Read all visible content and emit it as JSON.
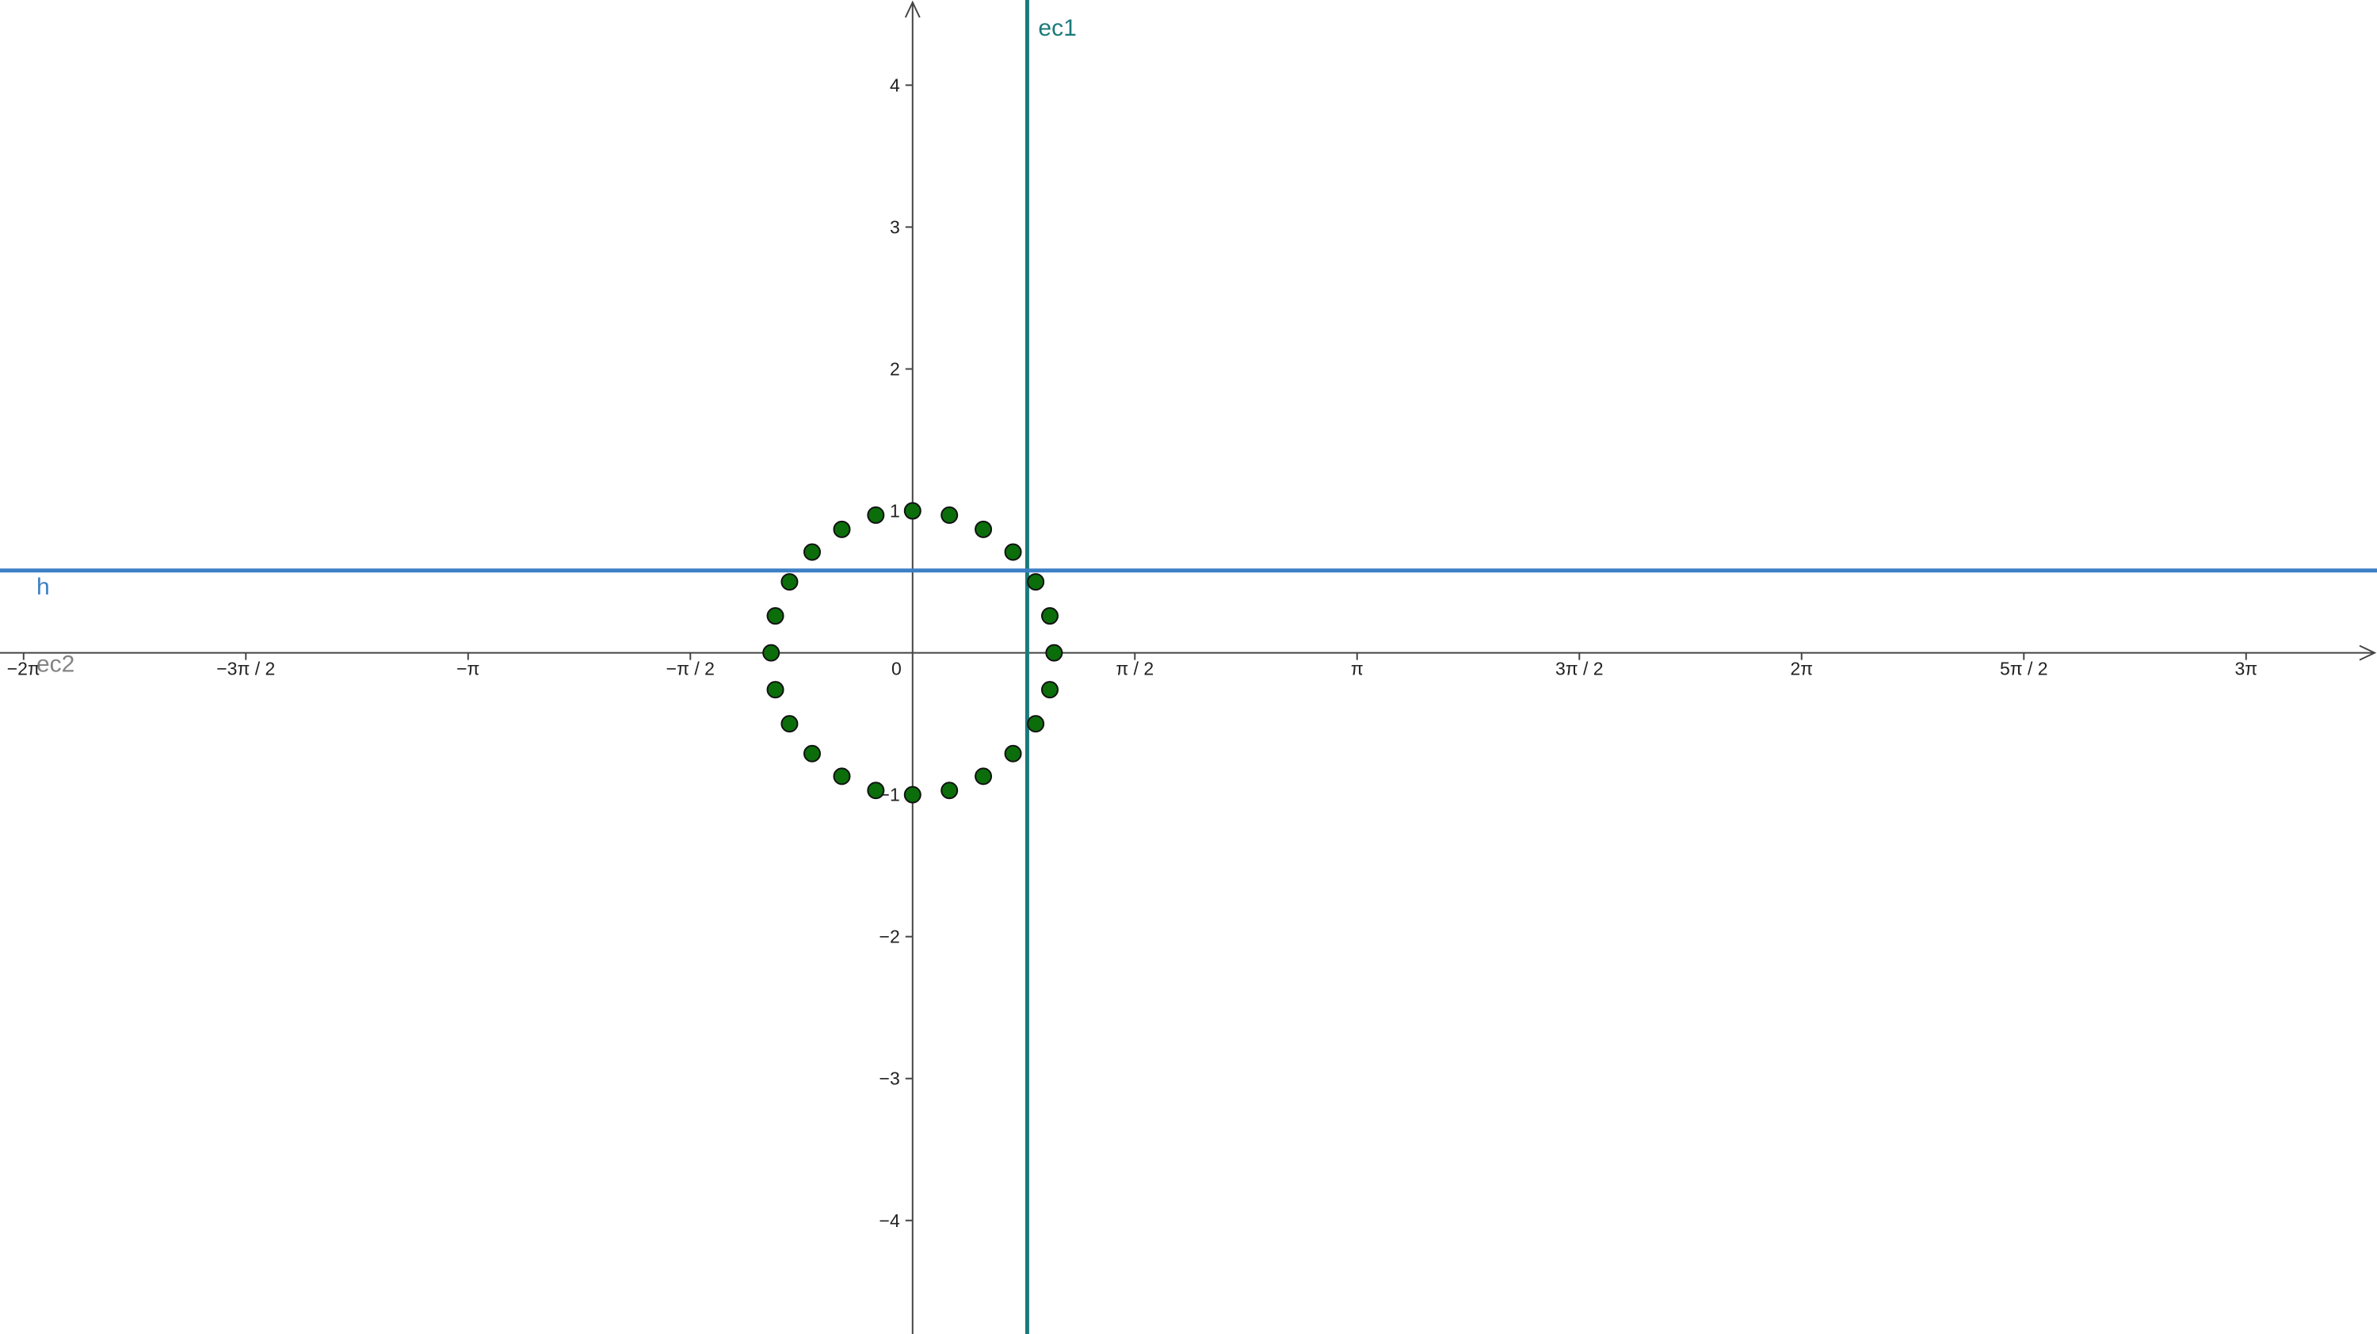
{
  "chart_data": {
    "type": "scatter",
    "x_unit": "radians",
    "xlim": [
      -6.45,
      10.35
    ],
    "ylim": [
      -4.8,
      4.6
    ],
    "grid": false,
    "x_ticks": [
      {
        "value": -6.283185,
        "label": "−2π"
      },
      {
        "value": -4.712389,
        "label": "−3π / 2"
      },
      {
        "value": -3.141593,
        "label": "−π"
      },
      {
        "value": -1.570796,
        "label": "−π / 2"
      },
      {
        "value": 1.570796,
        "label": "π / 2"
      },
      {
        "value": 3.141593,
        "label": "π"
      },
      {
        "value": 4.712389,
        "label": "3π / 2"
      },
      {
        "value": 6.283185,
        "label": "2π"
      },
      {
        "value": 7.853982,
        "label": "5π / 2"
      },
      {
        "value": 9.424778,
        "label": "3π"
      }
    ],
    "y_ticks": [
      {
        "value": -4,
        "label": "−4"
      },
      {
        "value": -3,
        "label": "−3"
      },
      {
        "value": -2,
        "label": "−2"
      },
      {
        "value": -1,
        "label": "−1"
      },
      {
        "value": 1,
        "label": "1"
      },
      {
        "value": 2,
        "label": "2"
      },
      {
        "value": 3,
        "label": "3"
      },
      {
        "value": 4,
        "label": "4"
      }
    ],
    "origin_label": "0",
    "lines": [
      {
        "name": "ec1",
        "orientation": "vertical",
        "value": 0.81,
        "color": "#1b7a7a"
      },
      {
        "name": "h",
        "orientation": "horizontal",
        "value": 0.58,
        "color": "#3d7fc4"
      },
      {
        "name": "ec2",
        "orientation": "horizontal",
        "value": 0,
        "color": "#777777"
      }
    ],
    "points": [
      {
        "x": 0.0,
        "y": 1.0
      },
      {
        "x": 0.26,
        "y": 0.97
      },
      {
        "x": 0.5,
        "y": 0.87
      },
      {
        "x": 0.71,
        "y": 0.71
      },
      {
        "x": 0.87,
        "y": 0.5
      },
      {
        "x": 0.97,
        "y": 0.26
      },
      {
        "x": 1.0,
        "y": 0.0
      },
      {
        "x": 0.97,
        "y": -0.26
      },
      {
        "x": 0.87,
        "y": -0.5
      },
      {
        "x": 0.71,
        "y": -0.71
      },
      {
        "x": 0.5,
        "y": -0.87
      },
      {
        "x": 0.26,
        "y": -0.97
      },
      {
        "x": 0.0,
        "y": -1.0
      },
      {
        "x": -0.26,
        "y": -0.97
      },
      {
        "x": -0.5,
        "y": -0.87
      },
      {
        "x": -0.71,
        "y": -0.71
      },
      {
        "x": -0.87,
        "y": -0.5
      },
      {
        "x": -0.97,
        "y": -0.26
      },
      {
        "x": -1.0,
        "y": 0.0
      },
      {
        "x": -0.97,
        "y": 0.26
      },
      {
        "x": -0.87,
        "y": 0.5
      },
      {
        "x": -0.71,
        "y": 0.71
      },
      {
        "x": -0.5,
        "y": 0.87
      },
      {
        "x": -0.26,
        "y": 0.97
      }
    ],
    "point_color": "#0b6e0b"
  }
}
